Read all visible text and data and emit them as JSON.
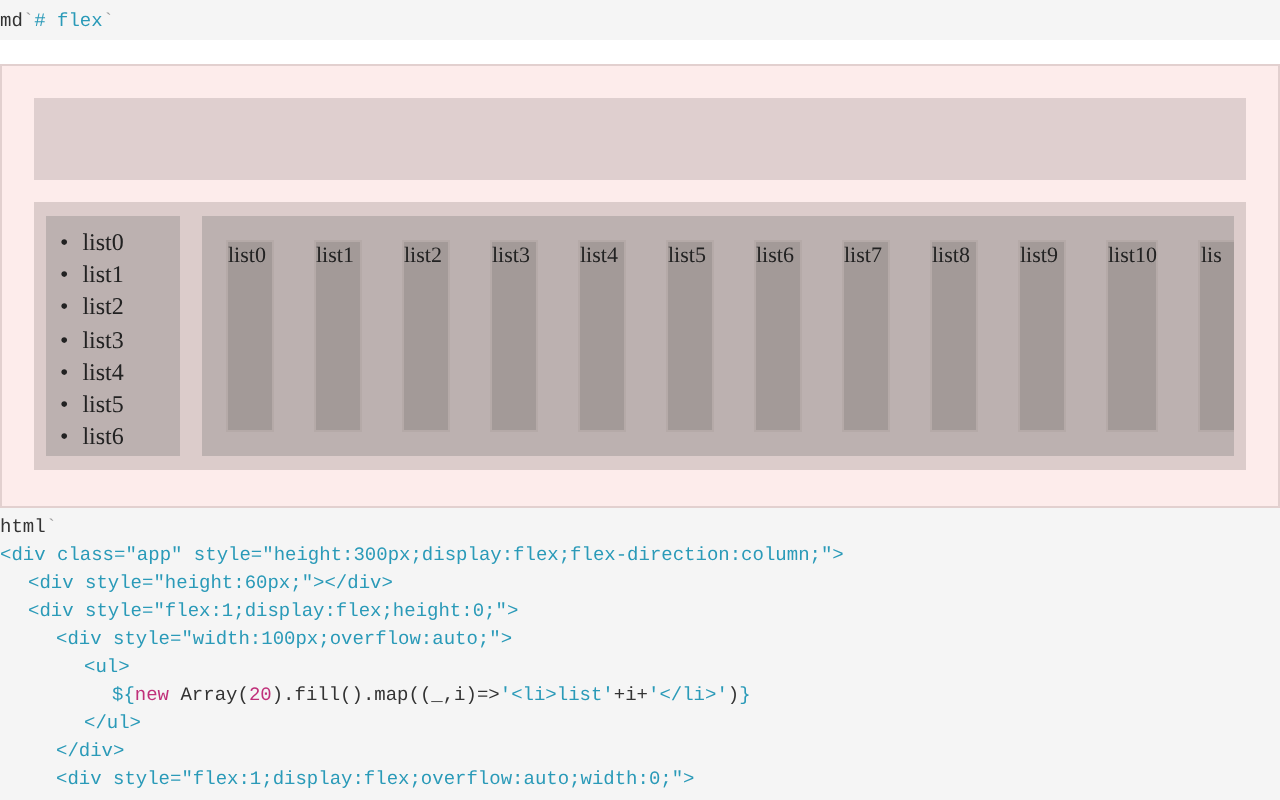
{
  "markdown_cell": {
    "tokens": [
      {
        "kind": "name",
        "text": "md"
      },
      {
        "kind": "tick",
        "text": "`"
      },
      {
        "kind": "string",
        "text": "# flex"
      },
      {
        "kind": "tick",
        "text": "`"
      }
    ]
  },
  "output": {
    "vertical_list": [
      {
        "marker": "•",
        "text": "list0"
      },
      {
        "marker": "•",
        "text": "list1"
      },
      {
        "marker": "•",
        "text": "list2"
      },
      {
        "marker": "•",
        "text": "list3"
      },
      {
        "marker": "•",
        "text": "list4"
      },
      {
        "marker": "•",
        "text": "list5"
      },
      {
        "marker": "•",
        "text": "list6"
      }
    ],
    "horizontal_items": [
      "list0",
      "list1",
      "list2",
      "list3",
      "list4",
      "list5",
      "list6",
      "list7",
      "list8",
      "list9",
      "list10",
      "lis"
    ]
  },
  "code_lines": [
    {
      "tokens": [
        {
          "kind": "name",
          "text": "html"
        },
        {
          "kind": "tick",
          "text": "`"
        }
      ]
    },
    {
      "tokens": [
        {
          "kind": "string",
          "text": "<div class=\"app\" style=\"height:300px;display:flex;flex-direction:column;\">"
        }
      ],
      "children": [
        {
          "tokens": [
            {
              "kind": "string",
              "text": "<div style=\"height:60px;\"></div>"
            }
          ]
        },
        {
          "tokens": [
            {
              "kind": "string",
              "text": "<div style=\"flex:1;display:flex;height:0;\">"
            }
          ],
          "children": [
            {
              "tokens": [
                {
                  "kind": "string",
                  "text": "<div style=\"width:100px;overflow:auto;\">"
                }
              ],
              "children": [
                {
                  "tokens": [
                    {
                      "kind": "string",
                      "text": "<ul>"
                    }
                  ],
                  "children": [
                    {
                      "tokens": [
                        {
                          "kind": "string",
                          "text": "${"
                        },
                        {
                          "kind": "keyword",
                          "text": "new"
                        },
                        {
                          "kind": "name",
                          "text": " Array("
                        },
                        {
                          "kind": "number",
                          "text": "20"
                        },
                        {
                          "kind": "name",
                          "text": ").fill().map((_,i)=>"
                        },
                        {
                          "kind": "string",
                          "text": "'<li>list'"
                        },
                        {
                          "kind": "name",
                          "text": "+i+"
                        },
                        {
                          "kind": "string",
                          "text": "'</li>'"
                        },
                        {
                          "kind": "name",
                          "text": ")"
                        },
                        {
                          "kind": "string",
                          "text": "}"
                        }
                      ]
                    }
                  ]
                },
                {
                  "tokens": [
                    {
                      "kind": "string",
                      "text": "</ul>"
                    }
                  ]
                }
              ]
            },
            {
              "tokens": [
                {
                  "kind": "string",
                  "text": "</div>"
                }
              ]
            },
            {
              "tokens": [
                {
                  "kind": "string",
                  "text": "<div style=\"flex:1;display:flex;overflow:auto;width:0;\">"
                }
              ]
            }
          ]
        }
      ]
    }
  ]
}
